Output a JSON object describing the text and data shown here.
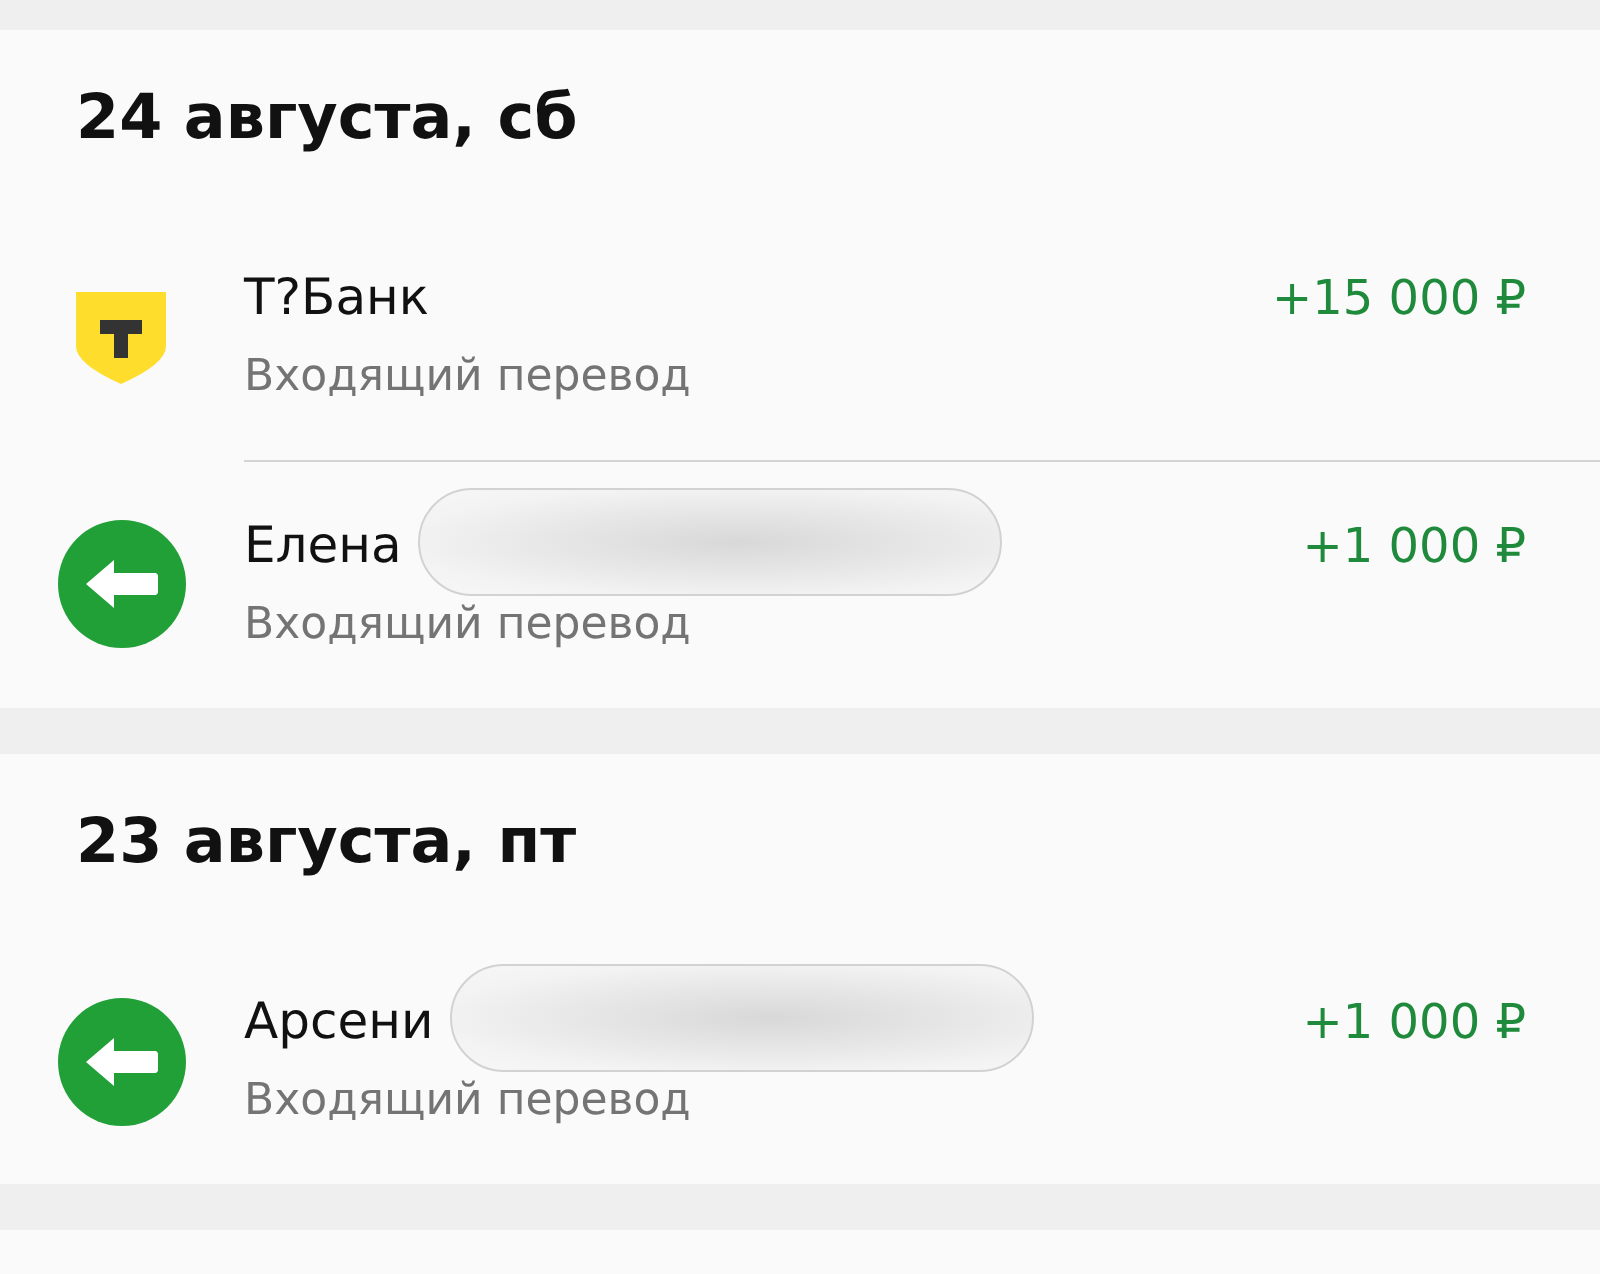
{
  "days": [
    {
      "date": "24 августа, сб",
      "transactions": [
        {
          "kind": "bank",
          "title": "Т?Банк",
          "subtitle": "Входящий перевод",
          "amount": "+15 000 ₽",
          "redacted": false
        },
        {
          "kind": "incoming",
          "title": "Елена",
          "subtitle": "Входящий перевод",
          "amount": "+1 000 ₽",
          "redacted": true
        }
      ]
    },
    {
      "date": "23 августа, пт",
      "transactions": [
        {
          "kind": "incoming",
          "title": "Арсени",
          "subtitle": "Входящий перевод",
          "amount": "+1 000 ₽",
          "redacted": true
        }
      ]
    }
  ]
}
